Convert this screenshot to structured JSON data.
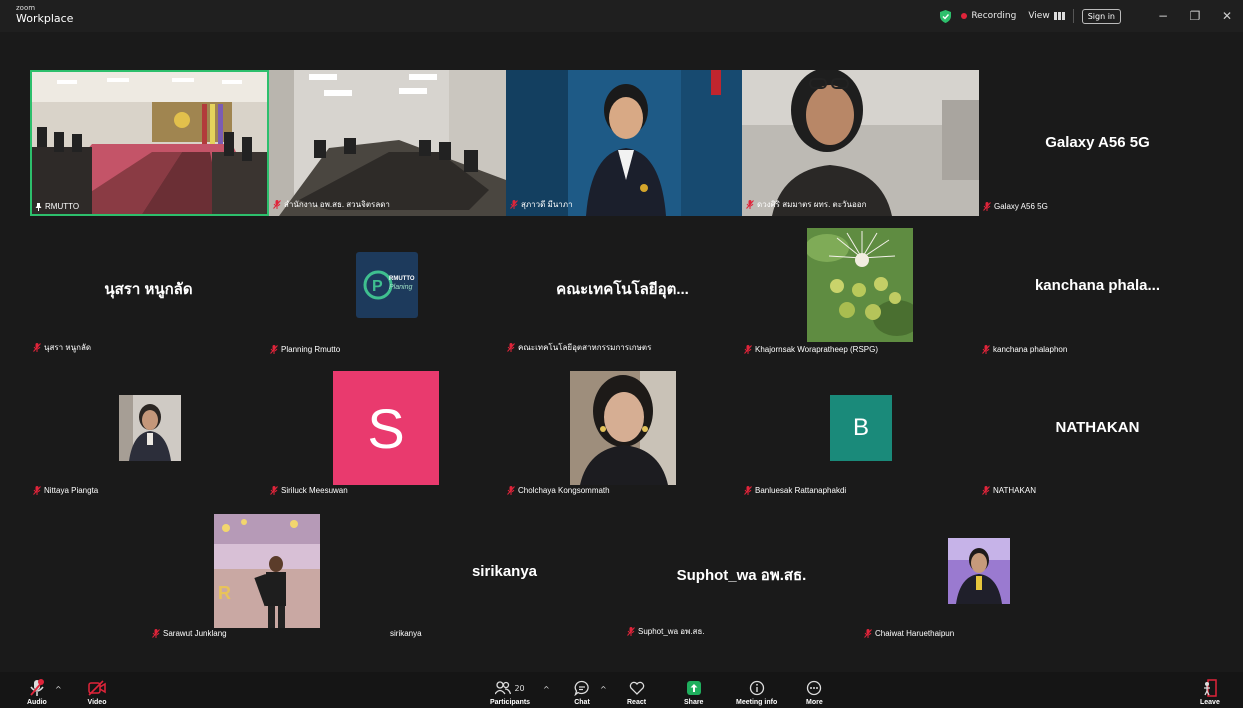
{
  "titlebar": {
    "brand_small": "zoom",
    "brand": "Workplace",
    "recording": "Recording",
    "view": "View",
    "sign_in": "Sign in",
    "minimize": "−",
    "restore": "❐",
    "close": "✕"
  },
  "participants": {
    "p1": {
      "label": "RMUTTO"
    },
    "p2": {
      "label": "สำนักงาน อพ.สธ. สวนจิตรลดา"
    },
    "p3": {
      "label": "สุภาวดี มีนาภา"
    },
    "p4": {
      "label": "ดวงศิริ สมมาตร ผทร. ตะวันออก"
    },
    "p5": {
      "label": "Galaxy A56 5G",
      "display": "Galaxy A56 5G"
    },
    "p6": {
      "label": "นุสรา หนูกลัด",
      "display": "นุสรา หนูกลัด"
    },
    "p7": {
      "label": "Planning Rmutto",
      "logo_main": "RMUTTO",
      "logo_sub": "Planing"
    },
    "p8": {
      "label": "คณะเทคโนโลยีอุตสาหกรรมการเกษตร",
      "display": "คณะเทคโนโลยีอุต..."
    },
    "p9": {
      "label": "Khajornsak Worapratheep (RSPG)"
    },
    "p10": {
      "label": "kanchana phalaphon",
      "display": "kanchana  phala..."
    },
    "p11": {
      "label": "Nittaya Piangta"
    },
    "p12": {
      "label": "Siriluck Meesuwan",
      "letter": "S"
    },
    "p13": {
      "label": "Cholchaya Kongsommath"
    },
    "p14": {
      "label": "Banluesak Rattanaphakdi",
      "letter": "B"
    },
    "p15": {
      "label": "NATHAKAN",
      "display": "NATHAKAN"
    },
    "p16": {
      "label": "Sarawut Junklang"
    },
    "p17": {
      "label": "sirikanya",
      "display": "sirikanya"
    },
    "p18": {
      "label": "Suphot_wa อพ.สธ.",
      "display": "Suphot_wa อพ.สธ."
    },
    "p19": {
      "label": "Chaiwat Haruethaipun"
    }
  },
  "toolbar": {
    "audio": "Audio",
    "video": "Video",
    "participants": "Participants",
    "participants_count": "20",
    "chat": "Chat",
    "react": "React",
    "share": "Share",
    "meeting_info": "Meeting info",
    "more": "More",
    "leave": "Leave"
  },
  "colors": {
    "active_speaker_border": "#2dbf6c",
    "recording_dot": "#e0243a",
    "siriluck_avatar": "#e93a6e",
    "banluesak_avatar": "#1a8a7a",
    "share_icon": "#1fae5d",
    "planning_logo_bg": "#1d3a5c"
  }
}
